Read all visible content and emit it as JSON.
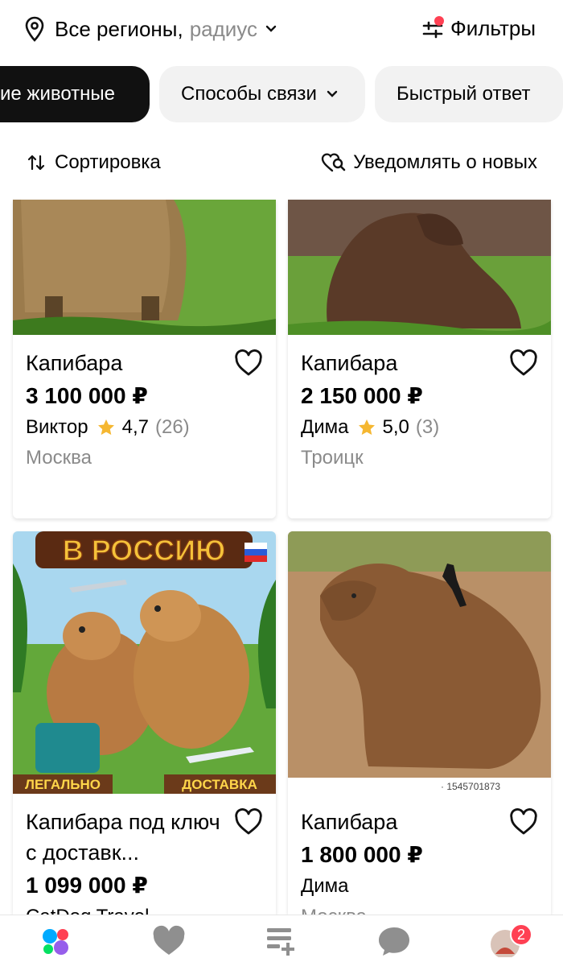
{
  "header": {
    "location_label": "Все регионы,",
    "radius_label": "радиус",
    "filters_label": "Фильтры"
  },
  "chips": [
    {
      "label": "ие животные",
      "active": true
    },
    {
      "label": "Способы связи",
      "has_dropdown": true
    },
    {
      "label": "Быстрый ответ"
    }
  ],
  "sortbar": {
    "sort_label": "Сортировка",
    "notify_label": "Уведомлять о новых"
  },
  "listings": [
    {
      "title": "Капибара",
      "price": "3 100 000 ₽",
      "seller": "Виктор",
      "rating": "4,7",
      "reviews": "(26)",
      "city": "Москва"
    },
    {
      "title": "Капибара",
      "price": "2 150 000 ₽",
      "seller": "Дима",
      "rating": "5,0",
      "reviews": "(3)",
      "city": "Троицк"
    },
    {
      "title": "Капибара под ключ с доставк...",
      "price": "1 099 000 ₽",
      "seller": "CatDog Travel",
      "city": "",
      "image_text": {
        "banner": "В РОССИЮ",
        "left_tag": "ЛЕГАЛЬНО",
        "right_tag": "ДОСТАВКА"
      }
    },
    {
      "title": "Капибара",
      "price": "1 800 000 ₽",
      "seller": "Дима",
      "city": "Москва",
      "image_text": {
        "watermark": "· 1545701873"
      }
    }
  ],
  "tabbar": {
    "badge_count": "2",
    "icons": [
      "home-icon",
      "favorites-icon",
      "post-ad-icon",
      "messages-icon",
      "profile-avatar"
    ]
  },
  "colors": {
    "accent_red": "#ff4053",
    "dark_chip": "#111111",
    "star": "#f5b731"
  }
}
